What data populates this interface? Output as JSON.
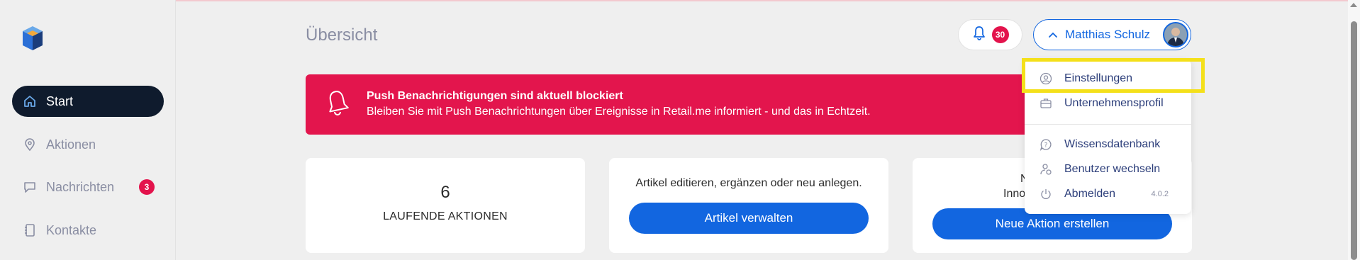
{
  "sidebar": {
    "items": [
      {
        "label": "Start",
        "icon": "home-icon",
        "active": true
      },
      {
        "label": "Aktionen",
        "icon": "location-pin-icon"
      },
      {
        "label": "Nachrichten",
        "icon": "chat-icon",
        "badge": "3"
      },
      {
        "label": "Kontakte",
        "icon": "contacts-book-icon"
      }
    ]
  },
  "header": {
    "title": "Übersicht",
    "notification_count": "30",
    "user_name": "Matthias Schulz"
  },
  "alert": {
    "title": "Push Benachrichtigungen sind aktuell blockiert",
    "text": "Bleiben Sie mit Push Benachrichtungen über Ereignisse in Retail.me informiert - und das in Echtzeit."
  },
  "cards": {
    "running": {
      "number": "6",
      "label": "LAUFENDE AKTIONEN"
    },
    "articles": {
      "text": "Artikel editieren, ergänzen oder neu anlegen.",
      "button": "Artikel verwalten"
    },
    "action": {
      "text_line1": "N",
      "text_line2": "Innov",
      "button": "Neue Aktion erstellen"
    }
  },
  "dropdown": {
    "items": [
      {
        "label": "Einstellungen",
        "icon": "user-circle-icon"
      },
      {
        "label": "Unternehmensprofil",
        "icon": "briefcase-icon"
      },
      {
        "label": "Wissensdatenbank",
        "icon": "help-bubble-icon"
      },
      {
        "label": "Benutzer wechseln",
        "icon": "switch-user-icon"
      },
      {
        "label": "Abmelden",
        "icon": "power-icon"
      }
    ],
    "version": "4.0.2"
  },
  "colors": {
    "accent": "#1266e0",
    "sidebar_active": "#0f1b2d",
    "alert": "#e3154d",
    "badge": "#e3134c",
    "highlight": "#f4e01a"
  }
}
